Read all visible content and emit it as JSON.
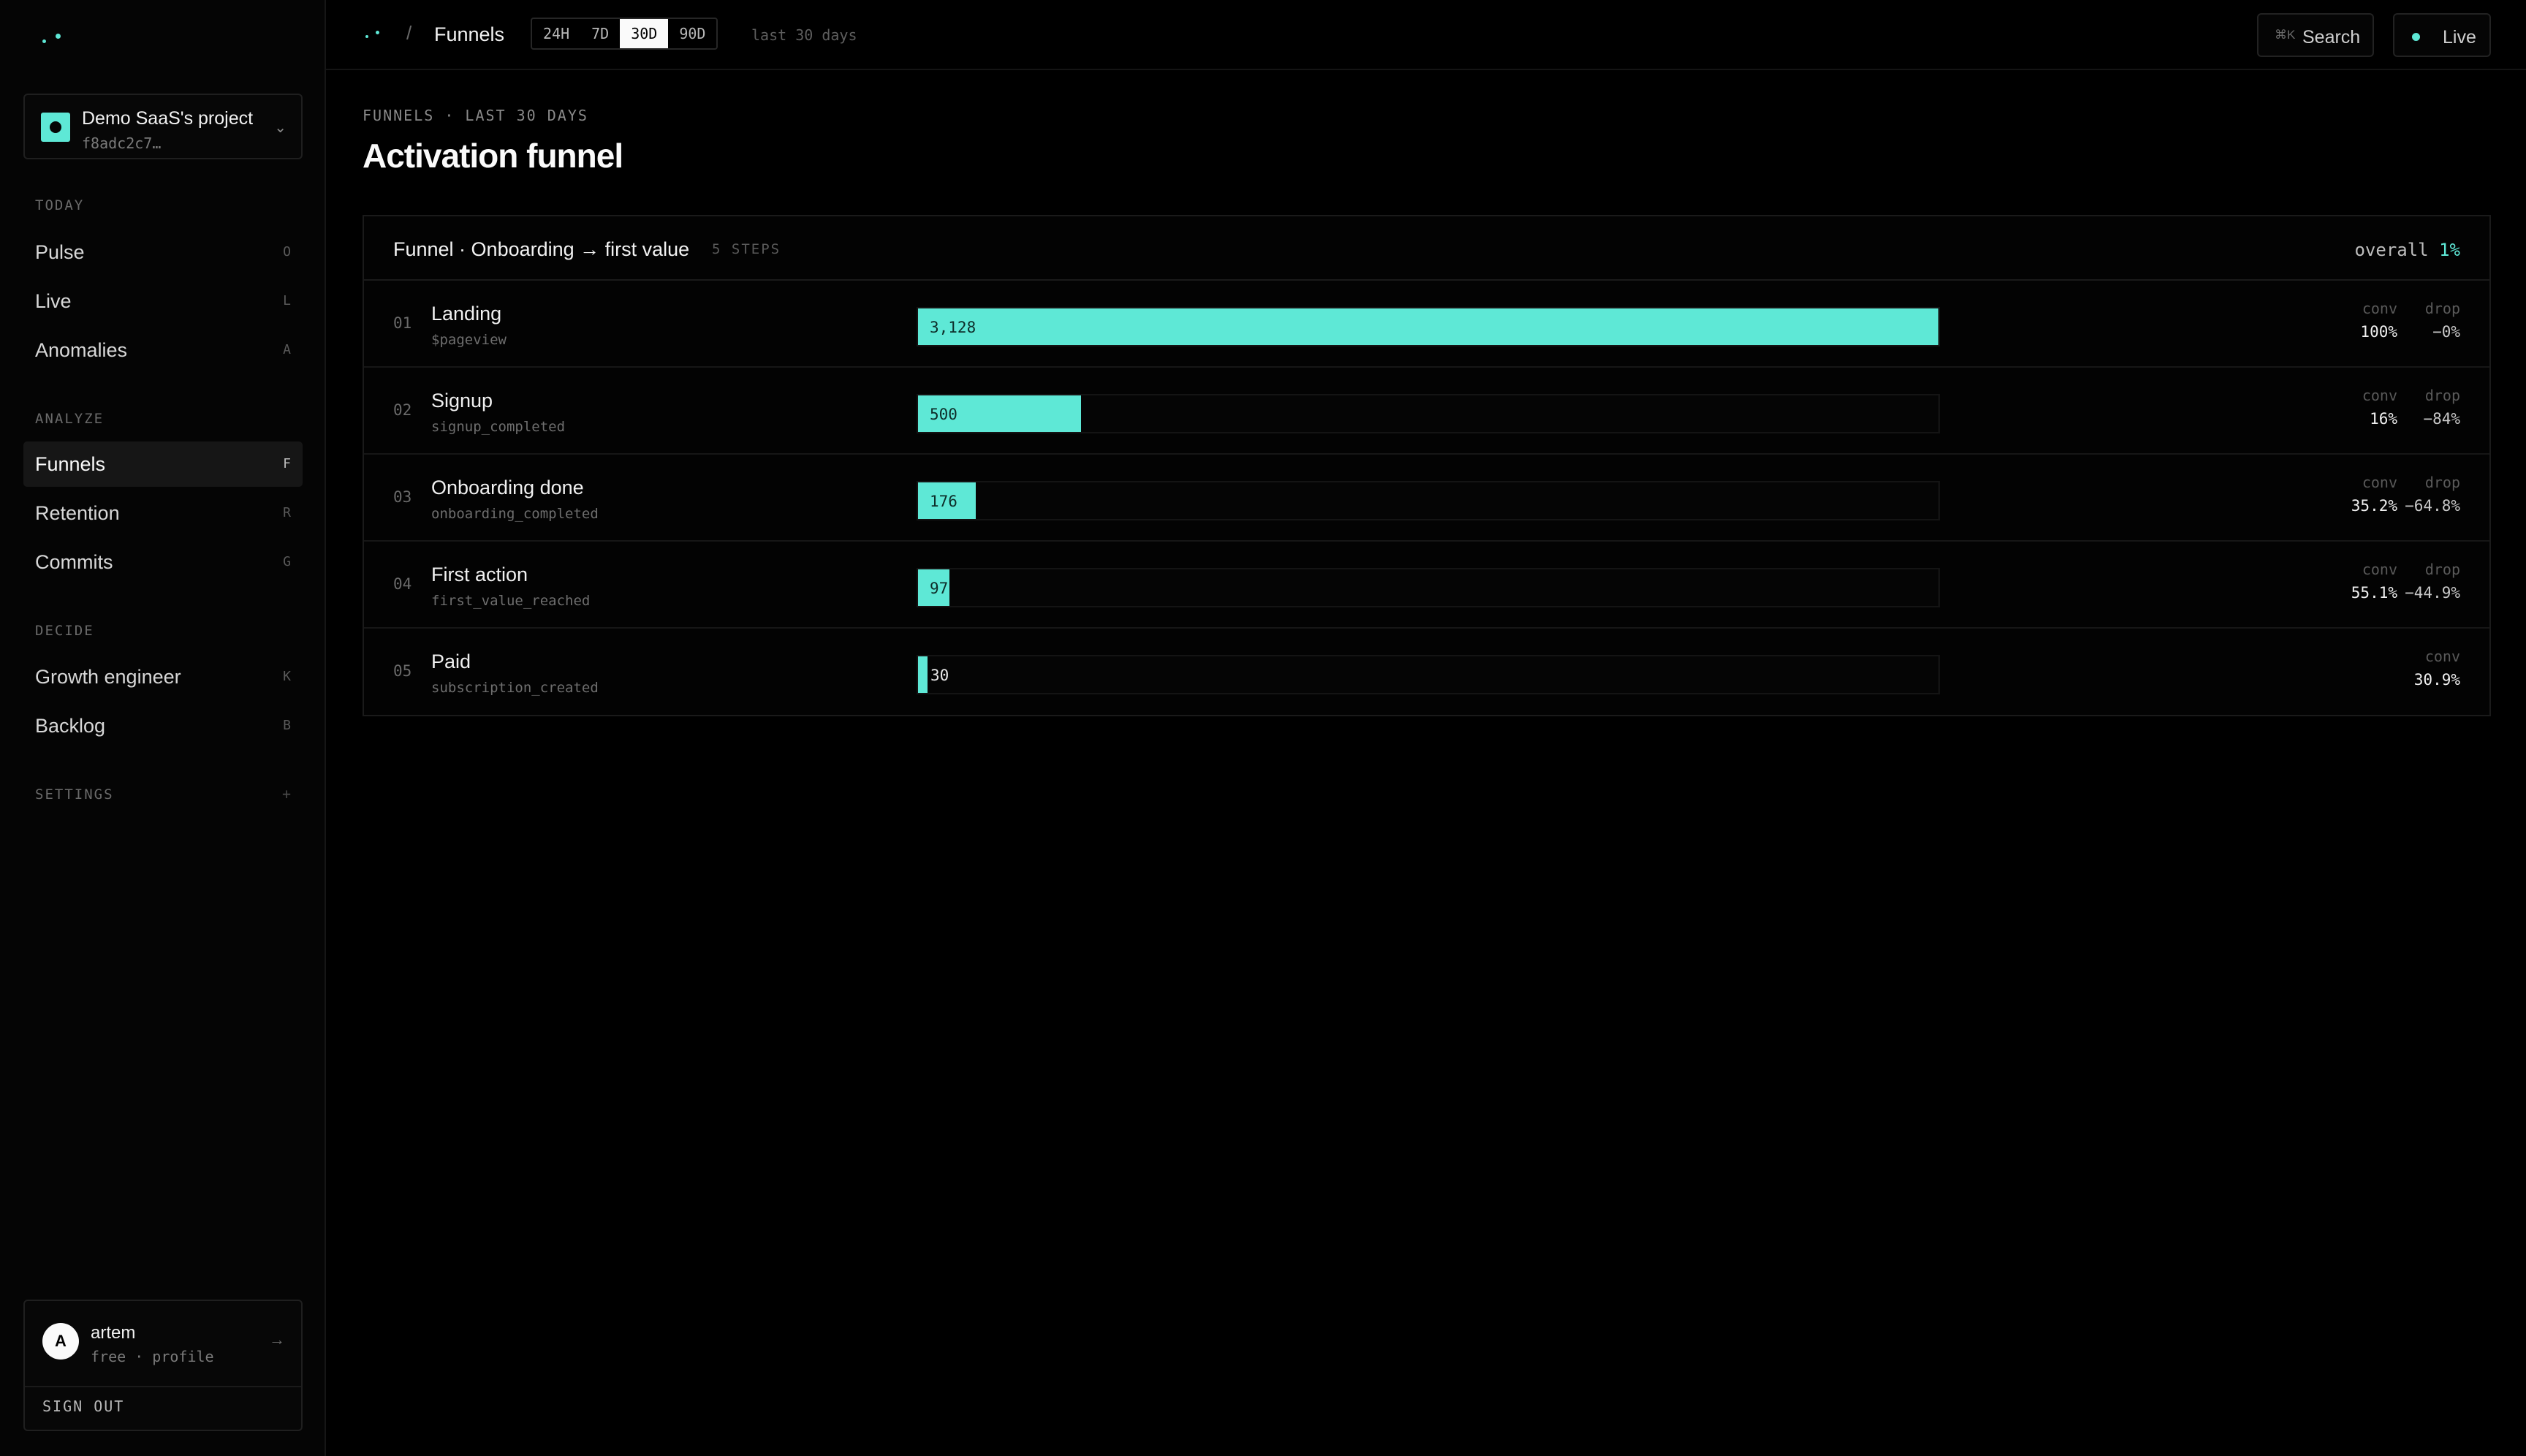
{
  "sidebar": {
    "project": {
      "name": "Demo SaaS's project",
      "id": "f8adc2c7…"
    },
    "sections": [
      {
        "label": "TODAY",
        "items": [
          {
            "label": "Pulse",
            "key": "O",
            "active": false
          },
          {
            "label": "Live",
            "key": "L",
            "active": false
          },
          {
            "label": "Anomalies",
            "key": "A",
            "active": false
          }
        ]
      },
      {
        "label": "ANALYZE",
        "items": [
          {
            "label": "Funnels",
            "key": "F",
            "active": true
          },
          {
            "label": "Retention",
            "key": "R",
            "active": false
          },
          {
            "label": "Commits",
            "key": "G",
            "active": false
          }
        ]
      },
      {
        "label": "DECIDE",
        "items": [
          {
            "label": "Growth engineer",
            "key": "K",
            "active": false
          },
          {
            "label": "Backlog",
            "key": "B",
            "active": false
          }
        ]
      }
    ],
    "settings": {
      "label": "SETTINGS",
      "icon": "+"
    },
    "user": {
      "initial": "A",
      "name": "artem",
      "meta": "free · profile",
      "arrow": "→",
      "signout": "SIGN OUT"
    }
  },
  "topbar": {
    "separator": "/",
    "page": "Funnels",
    "ranges": [
      {
        "label": "24H",
        "active": false
      },
      {
        "label": "7D",
        "active": false
      },
      {
        "label": "30D",
        "active": true
      },
      {
        "label": "90D",
        "active": false
      }
    ],
    "range_note": "last 30 days",
    "search": {
      "kbd": "⌘K",
      "label": "Search"
    },
    "live": {
      "label": "Live"
    }
  },
  "main": {
    "eyebrow": "FUNNELS · LAST 30 DAYS",
    "title": "Activation funnel",
    "funnel": {
      "title": "Funnel · Onboarding → first value",
      "steps_label": "5 STEPS",
      "overall_label": "overall",
      "overall_value": "1%",
      "conv_label": "conv",
      "drop_label": "drop",
      "max_count": 3128,
      "steps": [
        {
          "num": "01",
          "name": "Landing",
          "event": "$pageview",
          "count": 3128,
          "count_label": "3,128",
          "conv": "100%",
          "drop": "−0%"
        },
        {
          "num": "02",
          "name": "Signup",
          "event": "signup_completed",
          "count": 500,
          "count_label": "500",
          "conv": "16%",
          "drop": "−84%"
        },
        {
          "num": "03",
          "name": "Onboarding done",
          "event": "onboarding_completed",
          "count": 176,
          "count_label": "176",
          "conv": "35.2%",
          "drop": "−64.8%"
        },
        {
          "num": "04",
          "name": "First action",
          "event": "first_value_reached",
          "count": 97,
          "count_label": "97",
          "conv": "55.1%",
          "drop": "−44.9%"
        },
        {
          "num": "05",
          "name": "Paid",
          "event": "subscription_created",
          "count": 30,
          "count_label": "30",
          "conv": "30.9%",
          "drop": null
        }
      ]
    }
  },
  "colors": {
    "accent": "#5ee8d6",
    "background": "#000000",
    "panel": "#030303"
  }
}
